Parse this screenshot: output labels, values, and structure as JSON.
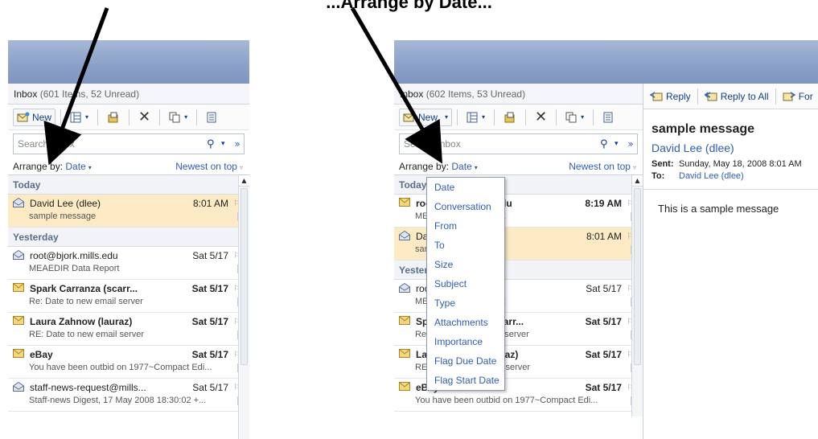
{
  "banner": {
    "text": "...Arrange by Date..."
  },
  "left_pane": {
    "folder": {
      "name": "Inbox",
      "count": "(601 Items, 52 Unread)"
    },
    "toolbar": {
      "new_label": "New"
    },
    "search": {
      "placeholder": "Search Inbox"
    },
    "arrange": {
      "label": "Arrange by:",
      "value": "Date",
      "order": "Newest on top"
    },
    "groups": [
      {
        "label": "Today",
        "messages": [
          {
            "from": "David Lee (dlee)",
            "date": "8:01 AM",
            "subject": "sample message",
            "unread": false,
            "selected": true,
            "icon": "read-envelope-icon"
          }
        ]
      },
      {
        "label": "Yesterday",
        "messages": [
          {
            "from": "root@bjork.mills.edu",
            "date": "Sat 5/17",
            "subject": "MEAEDIR Data Report",
            "unread": false,
            "selected": false,
            "icon": "read-envelope-icon"
          },
          {
            "from": "Spark Carranza (scarr...",
            "date": "Sat 5/17",
            "subject": "Re: Date to new email server",
            "unread": true,
            "selected": false,
            "icon": "unread-envelope-icon"
          },
          {
            "from": "Laura Zahnow (lauraz)",
            "date": "Sat 5/17",
            "subject": "RE: Date to new email server",
            "unread": true,
            "selected": false,
            "icon": "unread-envelope-icon"
          },
          {
            "from": "eBay",
            "date": "Sat 5/17",
            "subject": "You have been outbid on 1977~Compact Edi...",
            "unread": true,
            "selected": false,
            "icon": "unread-envelope-icon"
          },
          {
            "from": "staff-news-request@mills...",
            "date": "Sat 5/17",
            "subject": "Staff-news Digest, 17 May 2008 18:30:02 +...",
            "unread": false,
            "selected": false,
            "icon": "read-envelope-icon"
          }
        ]
      }
    ]
  },
  "right_pane": {
    "folder": {
      "name": "Inbox",
      "count": "(602 Items, 53 Unread)"
    },
    "toolbar": {
      "new_label": "New"
    },
    "search": {
      "placeholder": "Search Inbox"
    },
    "arrange": {
      "label": "Arrange by:",
      "value": "Date",
      "order": "Newest on top"
    },
    "groups": [
      {
        "label": "Today",
        "messages": [
          {
            "from": "root@bjork.mills.edu",
            "date": "8:19 AM",
            "subject": "MEAEDIR Data Report",
            "unread": true,
            "selected": false,
            "icon": "unread-envelope-icon"
          },
          {
            "from": "David Lee (dlee)",
            "date": "8:01 AM",
            "subject": "sample message",
            "unread": false,
            "selected": true,
            "icon": "read-envelope-icon"
          }
        ]
      },
      {
        "label": "Yesterday",
        "messages": [
          {
            "from": "root@bjork.mills.edu",
            "date": "Sat 5/17",
            "subject": "MEAEDIR Data Report",
            "unread": false,
            "selected": false,
            "icon": "read-envelope-icon"
          },
          {
            "from": "Spark Carranza (scarr...",
            "date": "Sat 5/17",
            "subject": "Re: Date to new email server",
            "unread": true,
            "selected": false,
            "icon": "unread-envelope-icon"
          },
          {
            "from": "Laura Zahnow (lauraz)",
            "date": "Sat 5/17",
            "subject": "RE: Date to new email server",
            "unread": true,
            "selected": false,
            "icon": "unread-envelope-icon"
          },
          {
            "from": "eBay",
            "date": "Sat 5/17",
            "subject": "You have been outbid on 1977~Compact Edi...",
            "unread": true,
            "selected": false,
            "icon": "unread-envelope-icon"
          }
        ]
      }
    ],
    "dropdown": {
      "options": [
        "Date",
        "Conversation",
        "From",
        "To",
        "Size",
        "Subject",
        "Type",
        "Attachments",
        "Importance",
        "Flag Due Date",
        "Flag Start Date"
      ]
    },
    "reading": {
      "toolbar": {
        "reply": "Reply",
        "reply_all": "Reply to All",
        "forward": "For"
      },
      "subject": "sample message",
      "sender": "David Lee (dlee)",
      "sent_label": "Sent:",
      "sent_value": "Sunday, May 18, 2008 8:01 AM",
      "to_label": "To:",
      "to_value": "David Lee (dlee)",
      "body": "This is a sample message"
    }
  },
  "colors": {
    "link_blue": "#2e5cb8",
    "selected_row": "#fbeac3",
    "titlebar": "#8aa0c8"
  }
}
